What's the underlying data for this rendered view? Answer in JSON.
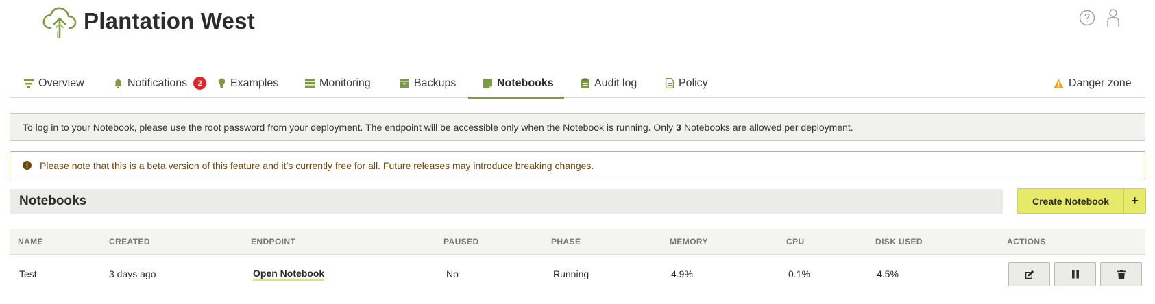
{
  "header": {
    "title": "Plantation West",
    "help_icon": "help-circle-icon",
    "user_icon": "user-icon"
  },
  "tabs": [
    {
      "label": "Overview",
      "icon": "overview-icon"
    },
    {
      "label": "Notifications",
      "icon": "bell-icon",
      "badge": "2"
    },
    {
      "label": "Examples",
      "icon": "lightbulb-icon"
    },
    {
      "label": "Monitoring",
      "icon": "monitoring-icon"
    },
    {
      "label": "Backups",
      "icon": "backup-icon"
    },
    {
      "label": "Notebooks",
      "icon": "notebook-icon",
      "active": true
    },
    {
      "label": "Audit log",
      "icon": "clipboard-icon"
    },
    {
      "label": "Policy",
      "icon": "document-icon"
    },
    {
      "label": "Danger zone",
      "icon": "warning-icon"
    }
  ],
  "info": {
    "text_before": "To log in to your Notebook, please use the root password from your deployment. The endpoint will be accessible only when the Notebook is running. Only",
    "count": "3",
    "text_after": "Notebooks are allowed per deployment."
  },
  "warning": {
    "text": "Please note that this is a beta version of this feature and it’s currently free for all. Future releases may introduce breaking changes."
  },
  "section": {
    "title": "Notebooks",
    "create_label": "Create Notebook",
    "create_plus": "+"
  },
  "table": {
    "headers": [
      "NAME",
      "CREATED",
      "ENDPOINT",
      "PAUSED",
      "PHASE",
      "MEMORY",
      "CPU",
      "DISK USED",
      "ACTIONS"
    ],
    "rows": [
      {
        "name": "Test",
        "created": "3 days ago",
        "endpoint": "Open Notebook",
        "paused": "No",
        "phase": "Running",
        "memory": "4.9%",
        "cpu": "0.1%",
        "disk_used": "4.5%"
      }
    ]
  },
  "colors": {
    "accent": "#7f9a46",
    "create_button": "#e6e96a",
    "badge": "#e0262c",
    "warning_text": "#6a4712",
    "danger_icon": "#f0a21a"
  }
}
